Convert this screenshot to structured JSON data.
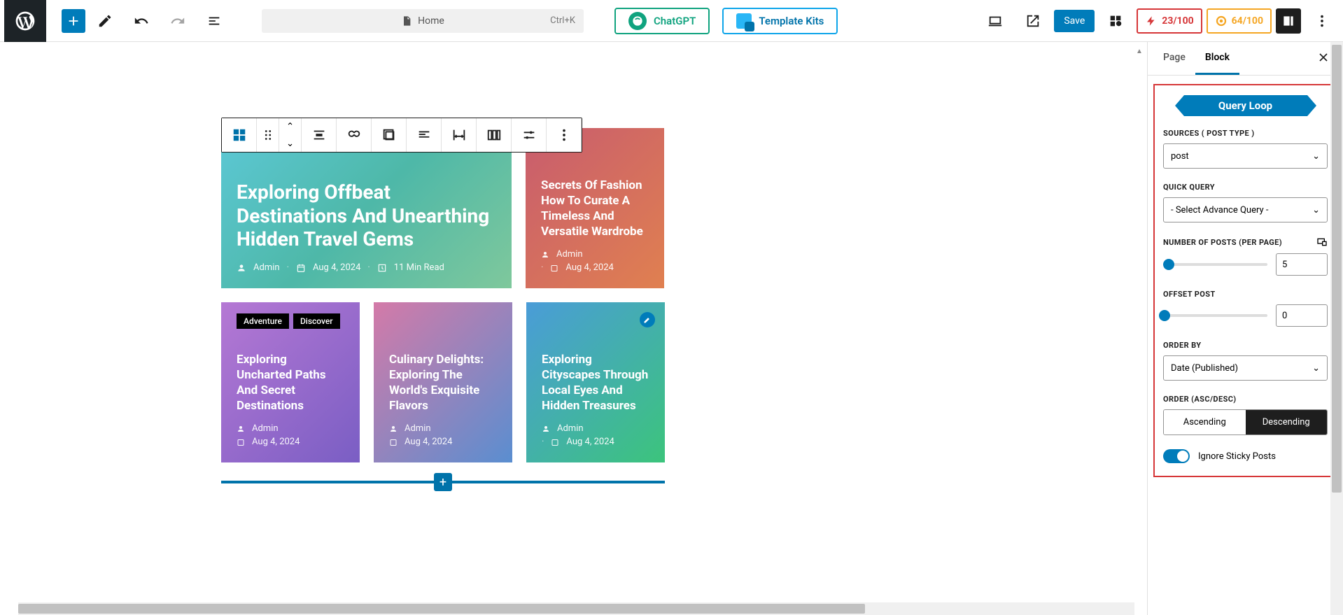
{
  "topbar": {
    "doc_title": "Home",
    "shortcut": "Ctrl+K",
    "chatgpt_label": "ChatGPT",
    "template_kits_label": "Template Kits",
    "save_label": "Save",
    "badge1": "23/100",
    "badge2": "64/100"
  },
  "sidebar": {
    "tab_page": "Page",
    "tab_block": "Block",
    "banner": "Query Loop",
    "sources_label": "SOURCES ( POST TYPE )",
    "sources_value": "post",
    "quick_query_label": "QUICK QUERY",
    "quick_query_value": "- Select Advance Query -",
    "num_posts_label": "NUMBER OF POSTS (PER PAGE)",
    "num_posts_value": "5",
    "offset_label": "OFFSET POST",
    "offset_value": "0",
    "orderby_label": "ORDER BY",
    "orderby_value": "Date (Published)",
    "order_label": "ORDER (ASC/DESC)",
    "asc_label": "Ascending",
    "desc_label": "Descending",
    "ignore_sticky_label": "Ignore Sticky Posts"
  },
  "cards": {
    "c1": {
      "title": "Exploring Offbeat Destinations And Unearthing Hidden Travel Gems",
      "author": "Admin",
      "date": "Aug 4, 2024",
      "read": "11 Min Read"
    },
    "c2": {
      "title": "Secrets Of Fashion How To Curate A Timeless And Versatile Wardrobe",
      "author": "Admin",
      "date": "Aug 4, 2024"
    },
    "c3": {
      "tag1": "Adventure",
      "tag2": "Discover",
      "title": "Exploring Uncharted Paths And Secret Destinations",
      "author": "Admin",
      "date": "Aug 4, 2024"
    },
    "c4": {
      "title": "Culinary Delights: Exploring The World's Exquisite Flavors",
      "author": "Admin",
      "date": "Aug 4, 2024"
    },
    "c5": {
      "title": "Exploring Cityscapes Through Local Eyes And Hidden Treasures",
      "author": "Admin",
      "date": "Aug 4, 2024"
    }
  }
}
